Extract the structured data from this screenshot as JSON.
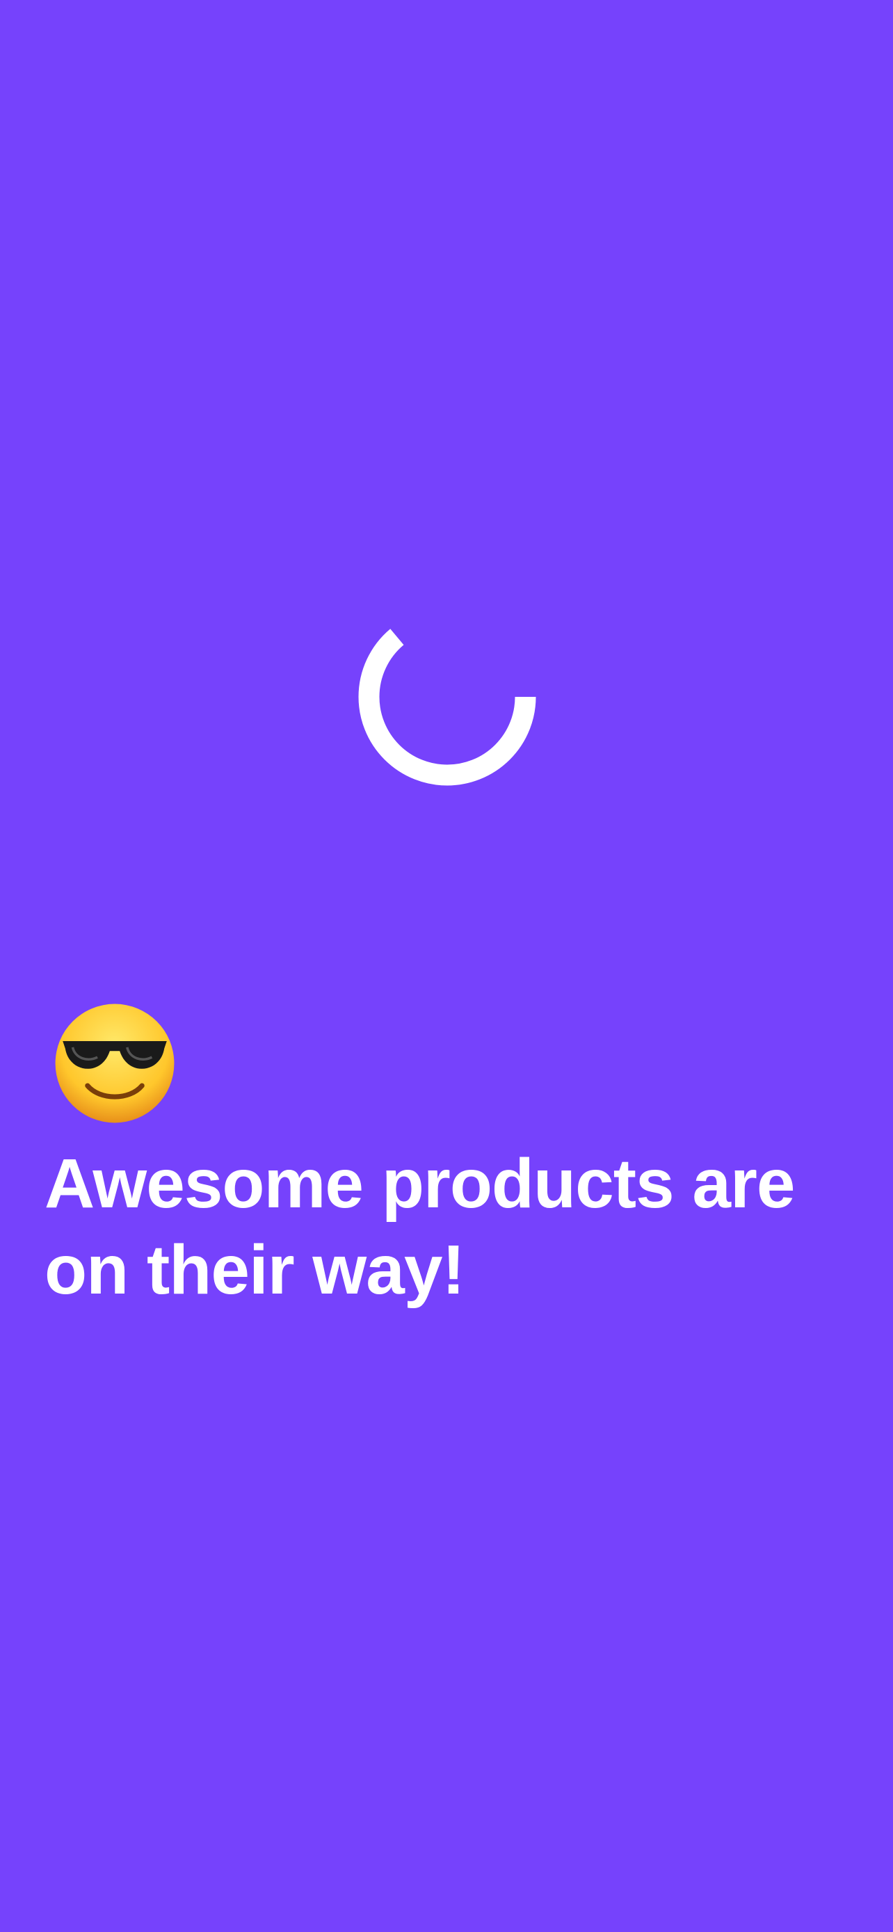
{
  "loading": {
    "headline": "Awesome products are on their way!",
    "emoji": "😎",
    "spinner_icon": "loading-spinner-icon",
    "emoji_icon": "smiling-face-with-sunglasses-icon"
  },
  "colors": {
    "background": "#7642FC",
    "foreground": "#FFFFFF"
  }
}
